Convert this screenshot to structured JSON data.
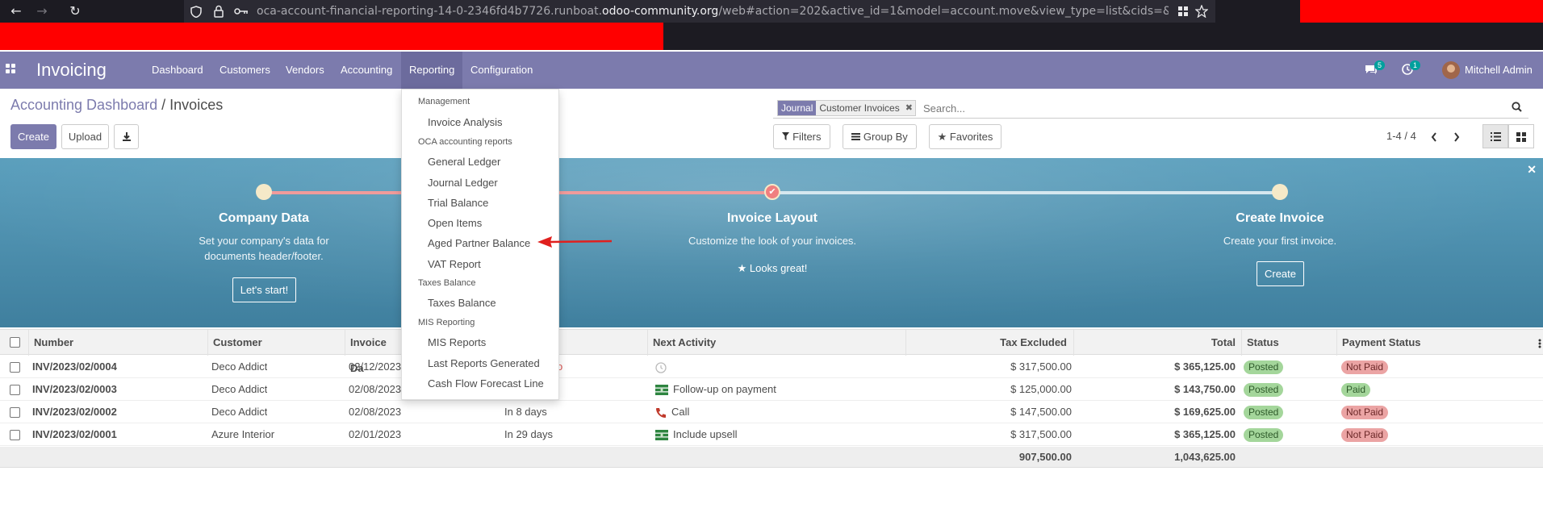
{
  "browser": {
    "url_prefix": "oca-account-financial-reporting-14-0-2346fd4b7726.runboat.",
    "url_domain": "odoo-community.org",
    "url_suffix": "/web#action=202&active_id=1&model=account.move&view_type=list&cids=&m"
  },
  "navbar": {
    "brand": "Invoicing",
    "menu": [
      "Dashboard",
      "Customers",
      "Vendors",
      "Accounting",
      "Reporting",
      "Configuration"
    ],
    "active_menu": "Reporting",
    "messages_count": "5",
    "activities_count": "1",
    "user_name": "Mitchell Admin"
  },
  "control_panel": {
    "breadcrumb_parent": "Accounting Dashboard",
    "breadcrumb_sep": "/",
    "breadcrumb_current": "Invoices",
    "create_label": "Create",
    "upload_label": "Upload",
    "facet_label": "Journal",
    "facet_value": "Customer Invoices",
    "search_placeholder": "Search...",
    "filters_label": "Filters",
    "groupby_label": "Group By",
    "favorites_label": "Favorites",
    "pager": "1-4 / 4"
  },
  "reporting_menu": {
    "sections": [
      {
        "header": "Management",
        "items": [
          "Invoice Analysis"
        ]
      },
      {
        "header": "OCA accounting reports",
        "items": [
          "General Ledger",
          "Journal Ledger",
          "Trial Balance",
          "Open Items",
          "Aged Partner Balance",
          "VAT Report"
        ]
      },
      {
        "header": "Taxes Balance",
        "items": [
          "Taxes Balance"
        ]
      },
      {
        "header": "MIS Reporting",
        "items": [
          "MIS Reports",
          "Last Reports Generated",
          "Cash Flow Forecast Line"
        ]
      }
    ]
  },
  "banner": {
    "steps": [
      {
        "title": "Company Data",
        "desc1": "Set your company's data for",
        "desc2": "documents header/footer.",
        "button": "Let's start!"
      },
      {
        "title": "Invoice Layout",
        "desc1": "Customize the look of your invoices.",
        "done": "Looks great!"
      },
      {
        "title": "Create Invoice",
        "desc1": "Create your first invoice.",
        "button": "Create"
      }
    ]
  },
  "table": {
    "columns": [
      "Number",
      "Customer",
      "Invoice Da",
      "Next Activity",
      "Tax Excluded",
      "Total",
      "Status",
      "Payment Status"
    ],
    "rows": [
      {
        "number": "INV/2023/02/0004",
        "customer": "Deco Addict",
        "date": "02/12/2023",
        "due": "o",
        "activity": "",
        "tax_excluded": "$ 317,500.00",
        "total": "$ 365,125.00",
        "status": "Posted",
        "payment": "Not Paid"
      },
      {
        "number": "INV/2023/02/0003",
        "customer": "Deco Addict",
        "date": "02/08/2023",
        "due": "",
        "activity": "Follow-up on payment",
        "tax_excluded": "$ 125,000.00",
        "total": "$ 143,750.00",
        "status": "Posted",
        "payment": "Paid"
      },
      {
        "number": "INV/2023/02/0002",
        "customer": "Deco Addict",
        "date": "02/08/2023",
        "due": "In 8 days",
        "activity": "Call",
        "tax_excluded": "$ 147,500.00",
        "total": "$ 169,625.00",
        "status": "Posted",
        "payment": "Not Paid"
      },
      {
        "number": "INV/2023/02/0001",
        "customer": "Azure Interior",
        "date": "02/01/2023",
        "due": "In 29 days",
        "activity": "Include upsell",
        "tax_excluded": "$ 317,500.00",
        "total": "$ 365,125.00",
        "status": "Posted",
        "payment": "Not Paid"
      }
    ],
    "footer_tax_excluded": "907,500.00",
    "footer_total": "1,043,625.00"
  },
  "colors": {
    "brand": "#7c7bad",
    "annotation_arrow": "#e0201e"
  }
}
